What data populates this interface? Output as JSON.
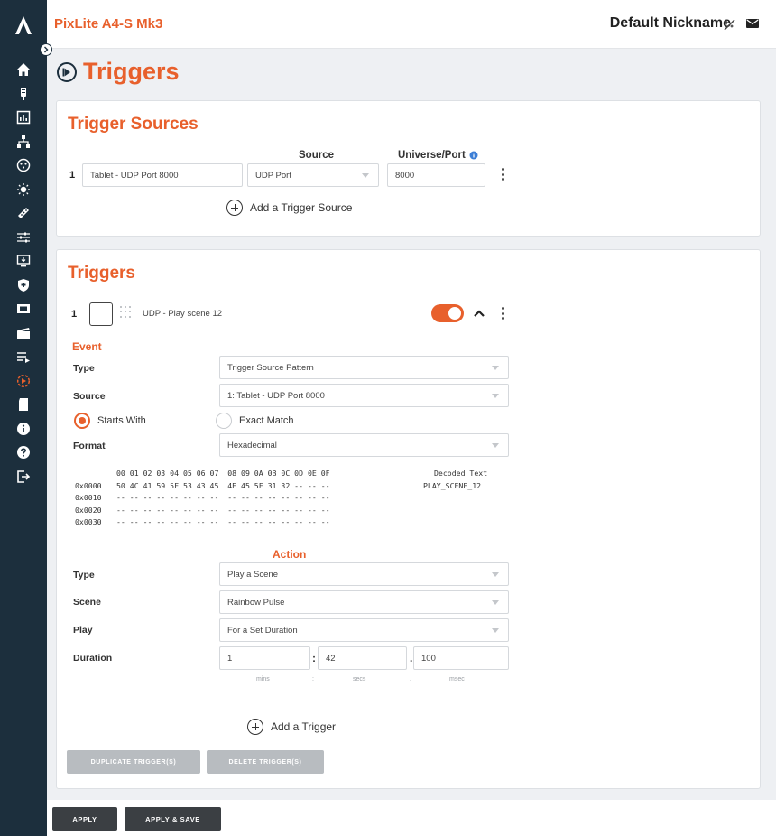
{
  "app": {
    "device_name": "PixLite A4-S Mk3",
    "nickname": "Default Nickname",
    "brand_color": "#e8602c",
    "sidebar_color": "#1c2f3d"
  },
  "sidebar": {
    "icons": [
      "home-icon",
      "probe-icon",
      "stats-icon",
      "network-icon",
      "dmx-icon",
      "light-icon",
      "pixel-tape-icon",
      "sliders-icon",
      "display-in-icon",
      "shield-icon",
      "film-icon",
      "clapper-icon",
      "playlist-icon",
      "triggers-icon",
      "sd-card-icon",
      "info-icon",
      "help-icon",
      "logout-icon"
    ]
  },
  "page": {
    "title": "Triggers"
  },
  "sources": {
    "title": "Trigger Sources",
    "col_source": "Source",
    "col_universe": "Universe/Port",
    "rows": [
      {
        "num": "1",
        "name": "Tablet - UDP Port 8000",
        "source": "UDP Port",
        "port": "8000"
      }
    ],
    "add_label": "Add a Trigger Source"
  },
  "triggers": {
    "title": "Triggers",
    "item": {
      "num": "1",
      "name": "UDP - Play scene 12",
      "enabled": true
    },
    "event": {
      "title": "Event",
      "type_label": "Type",
      "type_value": "Trigger Source Pattern",
      "source_label": "Source",
      "source_value": "1: Tablet - UDP Port 8000",
      "match_starts": "Starts With",
      "match_exact": "Exact Match",
      "format_label": "Format",
      "format_value": "Hexadecimal",
      "hex_header": "00 01 02 03 04 05 06 07  08 09 0A 0B 0C 0D 0E 0F",
      "hex_offsets": [
        "0x0000",
        "0x0010",
        "0x0020",
        "0x0030"
      ],
      "hex_rows": [
        "50 4C 41 59 5F 53 43 45  4E 45 5F 31 32 -- -- --",
        "-- -- -- -- -- -- -- --  -- -- -- -- -- -- -- --",
        "-- -- -- -- -- -- -- --  -- -- -- -- -- -- -- --",
        "-- -- -- -- -- -- -- --  -- -- -- -- -- -- -- --"
      ],
      "decoded_header": "Decoded Text",
      "decoded_rows": [
        "PLAY_SCENE_12",
        "",
        "",
        ""
      ]
    },
    "action": {
      "title": "Action",
      "type_label": "Type",
      "type_value": "Play a Scene",
      "scene_label": "Scene",
      "scene_value": "Rainbow Pulse",
      "play_label": "Play",
      "play_value": "For a Set Duration",
      "duration_label": "Duration",
      "mins": "1",
      "secs": "42",
      "msec": "100",
      "mins_label": "mins",
      "secs_label": "secs",
      "msec_label": "msec",
      "sep_colon": ":",
      "sep_dot": "."
    },
    "add_label": "Add a Trigger",
    "duplicate_label": "DUPLICATE TRIGGER(S)",
    "delete_label": "DELETE TRIGGER(S)"
  },
  "footer": {
    "apply_label": "APPLY",
    "apply_save_label": "APPLY & SAVE"
  }
}
